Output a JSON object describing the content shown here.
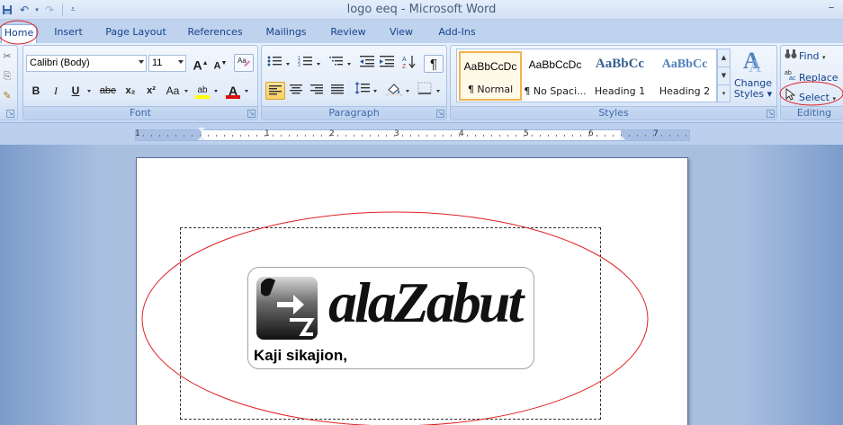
{
  "window": {
    "title": "logo eeq - Microsoft Word"
  },
  "quick_access": {
    "icons": [
      "save-icon",
      "undo-icon",
      "redo-icon",
      "customize-icon"
    ]
  },
  "tabs": [
    {
      "label": "Home",
      "active": true
    },
    {
      "label": "Insert"
    },
    {
      "label": "Page Layout"
    },
    {
      "label": "References"
    },
    {
      "label": "Mailings"
    },
    {
      "label": "Review"
    },
    {
      "label": "View"
    },
    {
      "label": "Add-Ins"
    }
  ],
  "font_group": {
    "label": "Font",
    "font_name": "Calibri (Body)",
    "font_size": "11",
    "grow_label": "A",
    "shrink_label": "A",
    "bold": "B",
    "italic": "I",
    "underline": "U",
    "strike": "abe",
    "subscript": "x₂",
    "superscript": "x²",
    "change_case": "Aa",
    "highlight": "ab",
    "font_color": "A"
  },
  "paragraph_group": {
    "label": "Paragraph",
    "show_marks": "¶"
  },
  "styles_group": {
    "label": "Styles",
    "items": [
      {
        "sample": "AaBbCcDc",
        "name": "¶ Normal",
        "selected": true
      },
      {
        "sample": "AaBbCcDc",
        "name": "¶ No Spaci..."
      },
      {
        "sample": "AaBbCc",
        "name": "Heading 1"
      },
      {
        "sample": "AaBbCc",
        "name": "Heading 2"
      }
    ],
    "change_styles": [
      "Change",
      "Styles"
    ]
  },
  "editing_group": {
    "label": "Editing",
    "find": "Find",
    "replace": "Replace",
    "select": "Select"
  },
  "ruler": {
    "numbers": [
      "1",
      "1",
      "2",
      "3",
      "4",
      "5",
      "6",
      "7"
    ]
  },
  "document": {
    "logo_word": "alaZabut",
    "logo_tagline": "Kaji sikajion,"
  },
  "colors": {
    "annotation_red": "#e02020",
    "highlight_yellow": "#ffff00",
    "font_red": "#e01010",
    "ribbon_text": "#15428b"
  }
}
